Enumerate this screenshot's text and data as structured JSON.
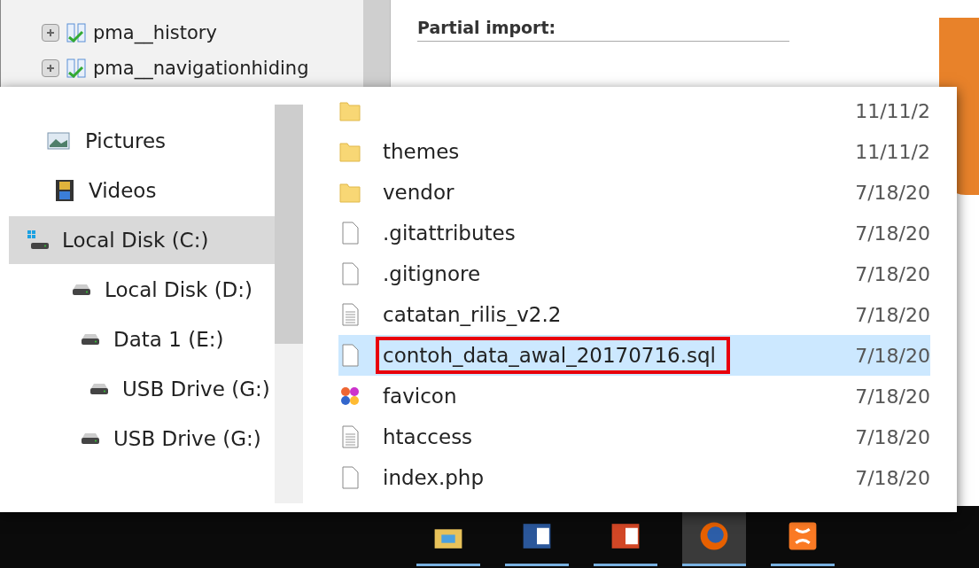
{
  "nav_tree": {
    "items": [
      {
        "label": "pma__history"
      },
      {
        "label": "pma__navigationhiding"
      }
    ]
  },
  "import_panel": {
    "heading": "Partial import:"
  },
  "file_dialog": {
    "nav_pane": {
      "items": [
        {
          "label": "Pictures",
          "kind": "pictures",
          "selected": false
        },
        {
          "label": "Videos",
          "kind": "videos",
          "selected": false
        },
        {
          "label": "Local Disk (C:)",
          "kind": "system-drive",
          "selected": true
        },
        {
          "label": "Local Disk (D:)",
          "kind": "drive",
          "selected": false
        },
        {
          "label": "Data 1 (E:)",
          "kind": "drive",
          "selected": false
        },
        {
          "label": "USB Drive (G:)",
          "kind": "drive",
          "selected": false
        },
        {
          "label": "USB Drive (G:)",
          "kind": "drive",
          "selected": false
        }
      ]
    },
    "files": [
      {
        "date": "11/11/2",
        "kind": "folder",
        "selected": false,
        "highlighted": false
      },
      {
        "name": "themes",
        "date": "11/11/2",
        "kind": "folder",
        "selected": false,
        "highlighted": false
      },
      {
        "name": "vendor",
        "date": "7/18/20",
        "kind": "folder",
        "selected": false,
        "highlighted": false
      },
      {
        "name": ".gitattributes",
        "date": "7/18/20",
        "kind": "file",
        "selected": false,
        "highlighted": false
      },
      {
        "name": ".gitignore",
        "date": "7/18/20",
        "kind": "file",
        "selected": false,
        "highlighted": false
      },
      {
        "name": "catatan_rilis_v2.2",
        "date": "7/18/20",
        "kind": "text",
        "selected": false,
        "highlighted": false
      },
      {
        "name": "contoh_data_awal_20170716.sql",
        "date": "7/18/20",
        "kind": "file",
        "selected": true,
        "highlighted": true
      },
      {
        "name": "favicon",
        "date": "7/18/20",
        "kind": "image",
        "selected": false,
        "highlighted": false
      },
      {
        "name": "htaccess",
        "date": "7/18/20",
        "kind": "text",
        "selected": false,
        "highlighted": false
      },
      {
        "name": "index.php",
        "date": "7/18/20",
        "kind": "file",
        "selected": false,
        "highlighted": false
      }
    ]
  },
  "taskbar": [
    {
      "kind": "explorer",
      "selected": false
    },
    {
      "kind": "word",
      "selected": false
    },
    {
      "kind": "powerpoint",
      "selected": false
    },
    {
      "kind": "firefox",
      "selected": true
    },
    {
      "kind": "xampp",
      "selected": false
    }
  ]
}
